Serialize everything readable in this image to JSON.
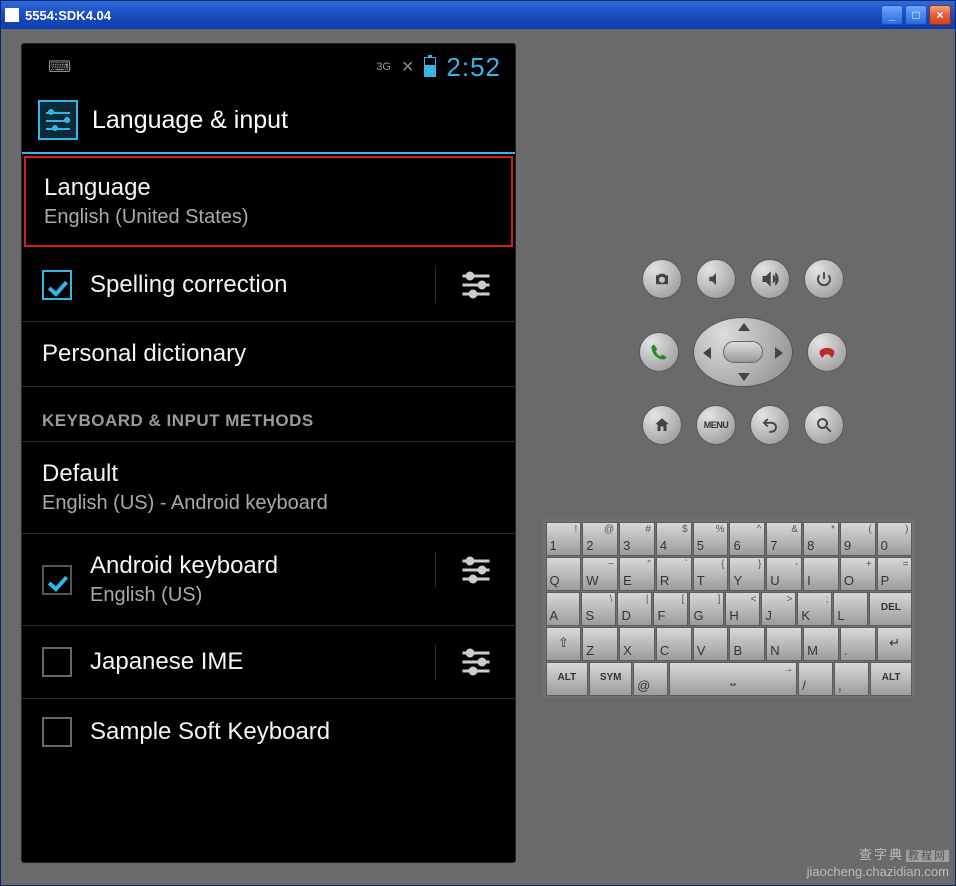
{
  "window": {
    "title": "5554:SDK4.04"
  },
  "statusbar": {
    "signal": "3G",
    "time": "2:52"
  },
  "header": {
    "title": "Language & input"
  },
  "settings": {
    "language": {
      "title": "Language",
      "sub": "English (United States)"
    },
    "spelling": {
      "title": "Spelling correction"
    },
    "personal_dict": {
      "title": "Personal dictionary"
    },
    "category_kbd": "KEYBOARD & INPUT METHODS",
    "default": {
      "title": "Default",
      "sub": "English (US) - Android keyboard"
    },
    "android_kbd": {
      "title": "Android keyboard",
      "sub": "English (US)"
    },
    "japanese": {
      "title": "Japanese IME"
    },
    "sample": {
      "title": "Sample Soft Keyboard"
    }
  },
  "ctrl": {
    "menu": "MENU"
  },
  "keyboard": {
    "row1": [
      {
        "m": "1",
        "a": "!"
      },
      {
        "m": "2",
        "a": "@"
      },
      {
        "m": "3",
        "a": "#"
      },
      {
        "m": "4",
        "a": "$"
      },
      {
        "m": "5",
        "a": "%"
      },
      {
        "m": "6",
        "a": "^"
      },
      {
        "m": "7",
        "a": "&"
      },
      {
        "m": "8",
        "a": "*"
      },
      {
        "m": "9",
        "a": "("
      },
      {
        "m": "0",
        "a": ")"
      }
    ],
    "row2": [
      {
        "m": "Q"
      },
      {
        "m": "W",
        "a": "~"
      },
      {
        "m": "E",
        "a": "\""
      },
      {
        "m": "R",
        "a": "`"
      },
      {
        "m": "T",
        "a": "{"
      },
      {
        "m": "Y",
        "a": "}"
      },
      {
        "m": "U",
        "a": "-"
      },
      {
        "m": "I"
      },
      {
        "m": "O",
        "a": "+"
      },
      {
        "m": "P",
        "a": "="
      }
    ],
    "row3": [
      {
        "m": "A"
      },
      {
        "m": "S",
        "a": "\\"
      },
      {
        "m": "D",
        "a": "|"
      },
      {
        "m": "F",
        "a": "["
      },
      {
        "m": "G",
        "a": "]"
      },
      {
        "m": "H",
        "a": "<"
      },
      {
        "m": "J",
        "a": ">"
      },
      {
        "m": "K",
        "a": ";"
      },
      {
        "m": "L",
        ":": ""
      },
      {
        "m": "DEL",
        "del": true
      }
    ],
    "row4": [
      {
        "m": "⇧",
        "shift": true
      },
      {
        "m": "Z"
      },
      {
        "m": "X"
      },
      {
        "m": "C"
      },
      {
        "m": "V"
      },
      {
        "m": "B"
      },
      {
        "m": "N"
      },
      {
        "m": "M"
      },
      {
        "m": ".",
        ",": ""
      },
      {
        "m": "↵",
        "enter": true
      }
    ],
    "row5": {
      "alt": "ALT",
      "sym": "SYM",
      "at": "@",
      "slash": "/",
      "comma": ",",
      "alt2": "ALT"
    }
  },
  "watermark": {
    "top": "查字典",
    "tag": "教程网",
    "url": "jiaocheng.chazidian.com"
  }
}
